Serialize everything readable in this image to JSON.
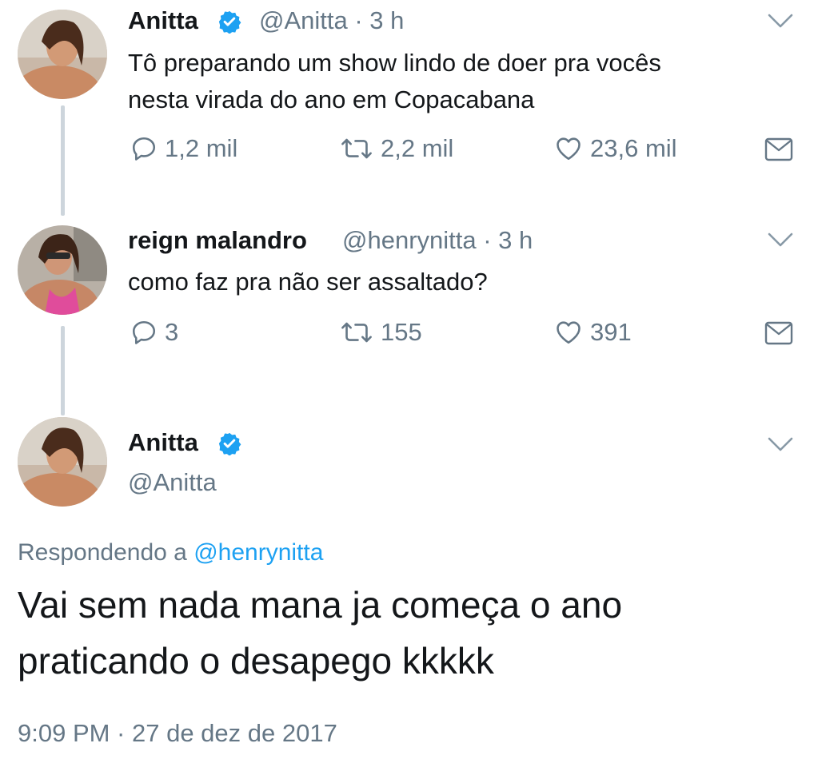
{
  "tweets": [
    {
      "name": "Anitta",
      "handle": "@Anitta",
      "time": "· 3 h",
      "text_lines": [
        "Tô preparando um show lindo de doer pra vocês",
        "nesta virada do ano em Copacabana"
      ],
      "verified": true,
      "replies": "1,2 mil",
      "retweets": "2,2 mil",
      "likes": "23,6 mil"
    },
    {
      "name": "reign malandro",
      "handle": "@henrynitta",
      "time": "· 3 h",
      "text_lines": [
        "como faz pra não ser assaltado?"
      ],
      "verified": false,
      "replies": "3",
      "retweets": "155",
      "likes": "391"
    }
  ],
  "main": {
    "name": "Anitta",
    "handle": "@Anitta",
    "verified": true,
    "reply_prefix": "Respondendo a",
    "reply_to": "@henrynitta",
    "text_lines": [
      "Vai sem nada mana ja começa o ano",
      "praticando o desapego kkkkk"
    ],
    "timestamp": "9:09 PM · 27 de dez de 2017"
  },
  "colors": {
    "link": "#1da1f2",
    "muted": "#657786",
    "verified": "#1da1f2",
    "thread_line": "#cdd5dc"
  },
  "icons": [
    "reply-icon",
    "retweet-icon",
    "like-icon",
    "direct-message-icon",
    "chevron-down-icon",
    "verified-badge-icon"
  ]
}
